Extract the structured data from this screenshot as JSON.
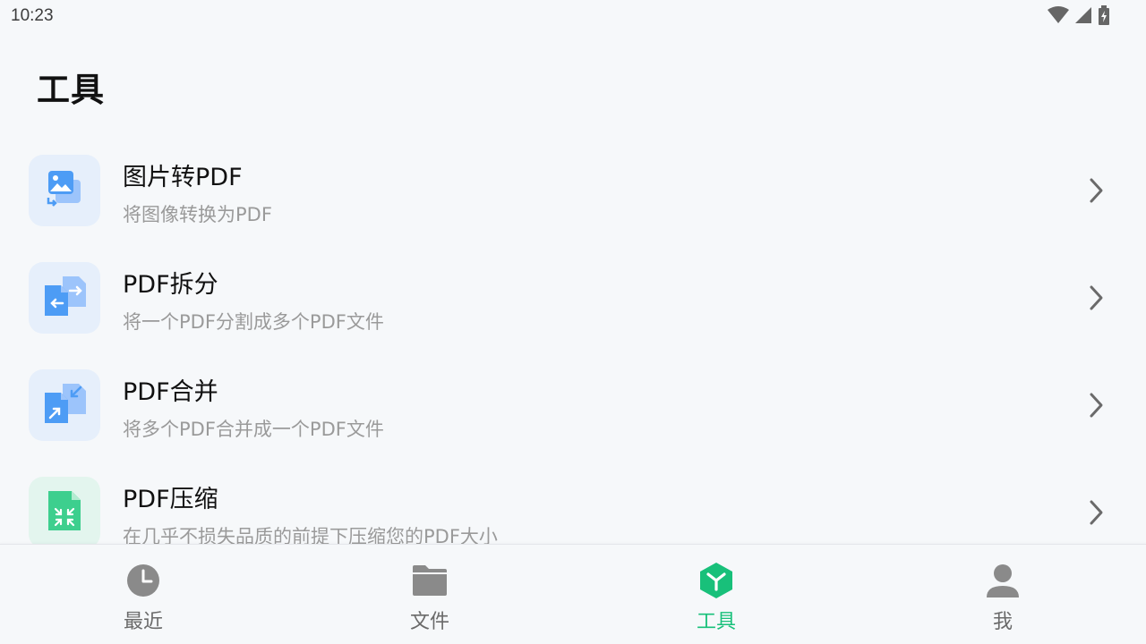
{
  "status_bar": {
    "time": "10:23",
    "icons": [
      "wifi-icon",
      "cellular-signal-icon",
      "battery-charging-icon"
    ]
  },
  "page": {
    "title": "工具"
  },
  "tools": [
    {
      "name": "图片转PDF",
      "description": "将图像转换为PDF",
      "icon": "image-to-pdf-icon"
    },
    {
      "name": "PDF拆分",
      "description": "将一个PDF分割成多个PDF文件",
      "icon": "pdf-split-icon"
    },
    {
      "name": "PDF合并",
      "description": "将多个PDF合并成一个PDF文件",
      "icon": "pdf-merge-icon"
    },
    {
      "name": "PDF压缩",
      "description": "在几乎不损失品质的前提下压缩您的PDF大小",
      "icon": "pdf-compress-icon"
    }
  ],
  "bottom_nav": {
    "items": [
      {
        "label": "最近",
        "icon": "clock-icon",
        "active": false
      },
      {
        "label": "文件",
        "icon": "folder-icon",
        "active": false
      },
      {
        "label": "工具",
        "icon": "toolbox-icon",
        "active": true
      },
      {
        "label": "我",
        "icon": "person-icon",
        "active": false
      }
    ]
  },
  "colors": {
    "background": "#f6f8fa",
    "accent": "#18c07a",
    "icon_blue": "#4d9cf5",
    "icon_green": "#3dcf8e",
    "inactive_nav": "#8a8a8a"
  }
}
